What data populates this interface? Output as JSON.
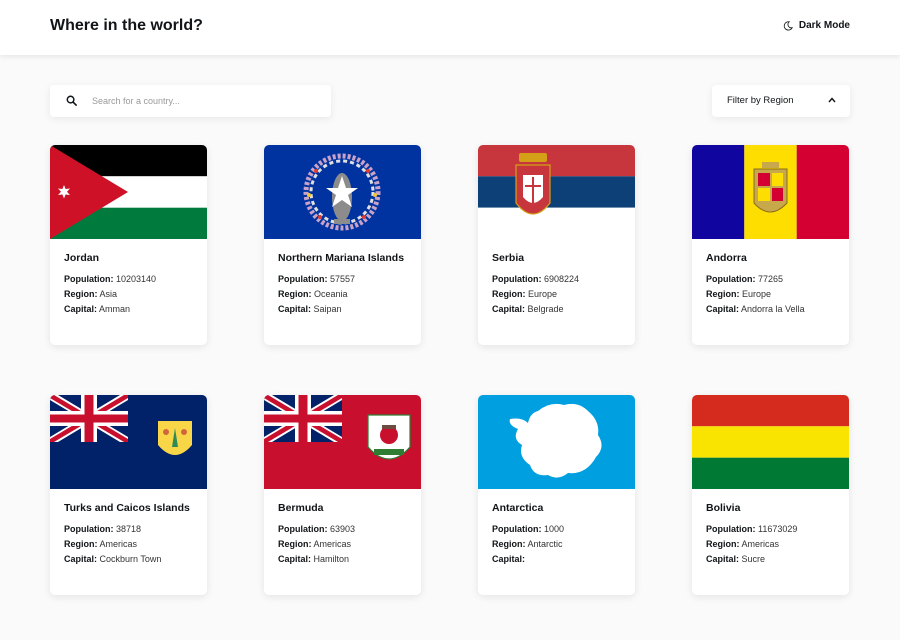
{
  "header": {
    "title": "Where in the world?",
    "dark_mode_label": "Dark Mode"
  },
  "search": {
    "placeholder": "Search for a country...",
    "value": ""
  },
  "filter": {
    "label": "Filter by Region"
  },
  "labels": {
    "population": "Population:",
    "region": "Region:",
    "capital": "Capital:"
  },
  "countries": [
    {
      "name": "Jordan",
      "population": "10203140",
      "region": "Asia",
      "capital": "Amman"
    },
    {
      "name": "Northern Mariana Islands",
      "population": "57557",
      "region": "Oceania",
      "capital": "Saipan"
    },
    {
      "name": "Serbia",
      "population": "6908224",
      "region": "Europe",
      "capital": "Belgrade"
    },
    {
      "name": "Andorra",
      "population": "77265",
      "region": "Europe",
      "capital": "Andorra la Vella"
    },
    {
      "name": "Turks and Caicos Islands",
      "population": "38718",
      "region": "Americas",
      "capital": "Cockburn Town"
    },
    {
      "name": "Bermuda",
      "population": "63903",
      "region": "Americas",
      "capital": "Hamilton"
    },
    {
      "name": "Antarctica",
      "population": "1000",
      "region": "Antarctic",
      "capital": ""
    },
    {
      "name": "Bolivia",
      "population": "11673029",
      "region": "Americas",
      "capital": "Sucre"
    }
  ],
  "colors": {
    "background": "#fafafa",
    "card": "#ffffff",
    "text": "#111517"
  }
}
